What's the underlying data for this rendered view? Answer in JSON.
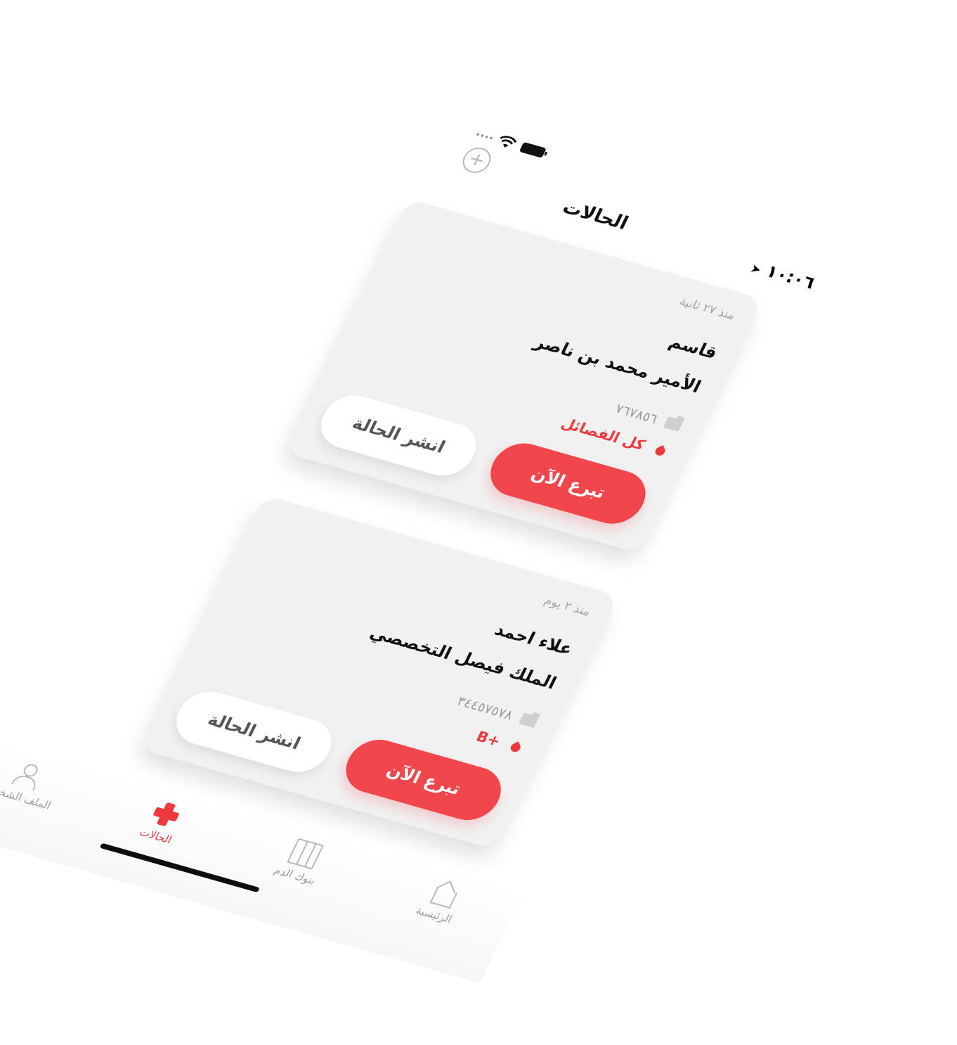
{
  "status_bar": {
    "time": "١٠:٠٦",
    "location_arrow": "➤"
  },
  "header": {
    "title": "الحالات",
    "add_button": "+"
  },
  "cases": [
    {
      "time_ago": "منذ ٢٧ ثانية",
      "patient_name": "قاسم",
      "hospital": "الأمير محمد بن ناصر",
      "file_number": "٧٦٧٨٥٦",
      "blood_type": "كل الفصائل",
      "donate_label": "تبرع الآن",
      "share_label": "انشر الحالة"
    },
    {
      "time_ago": "منذ ٢ يوم",
      "patient_name": "علاء احمد",
      "hospital": "الملك فيصل التخصصي",
      "file_number": "٣٤٤٥٧٥٧٨",
      "blood_type": "B+",
      "donate_label": "تبرع الآن",
      "share_label": "انشر الحالة"
    }
  ],
  "tabbar": {
    "items": [
      {
        "label": "الرئيسية",
        "icon": "home-icon",
        "active": false
      },
      {
        "label": "بنوك الدم",
        "icon": "map-icon",
        "active": false
      },
      {
        "label": "الحالات",
        "icon": "cross-icon",
        "active": true
      },
      {
        "label": "الملف الشخصي",
        "icon": "profile-icon",
        "active": false
      }
    ]
  },
  "colors": {
    "accent": "#f2464d",
    "card_bg": "#f1f1f1",
    "muted_text": "#a3a3a3"
  }
}
